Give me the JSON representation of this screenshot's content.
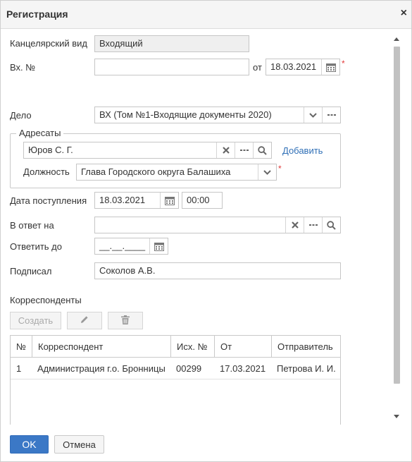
{
  "dialog": {
    "title": "Регистрация",
    "close_glyph": "×"
  },
  "form": {
    "office_type": {
      "label": "Канцелярский вид",
      "value": "Входящий"
    },
    "incoming_no": {
      "label": "Вх. №",
      "value": "",
      "date_label": "от",
      "date_value": "18.03.2021"
    },
    "case": {
      "label": "Дело",
      "value": "ВХ (Том №1-Входящие документы 2020)"
    },
    "addressees": {
      "legend": "Адресаты",
      "person": "Юров С. Г.",
      "add_link": "Добавить",
      "position_label": "Должность",
      "position_value": "Глава Городского округа Балашиха"
    },
    "receipt_date": {
      "label": "Дата поступления",
      "date_value": "18.03.2021",
      "time_value": "00:00"
    },
    "reply_to": {
      "label": "В ответ на",
      "value": ""
    },
    "reply_by": {
      "label": "Ответить до",
      "value": "__.__.____"
    },
    "signed_by": {
      "label": "Подписал",
      "value": "Соколов А.В."
    }
  },
  "correspondents": {
    "title": "Корреспонденты",
    "create_label": "Создать",
    "columns": [
      "№",
      "Корреспондент",
      "Исх. №",
      "От",
      "Отправитель"
    ],
    "rows": [
      [
        "1",
        "Администрация г.о. Бронницы",
        "00299",
        "17.03.2021",
        "Петрова И. И."
      ]
    ]
  },
  "footer": {
    "ok_label": "OK",
    "cancel_label": "Отмена"
  },
  "colors": {
    "primary": "#3b78c6",
    "required": "#e23b3b",
    "link": "#2f6fb6"
  },
  "icons": [
    "calendar-icon",
    "chevron-down-icon",
    "more-icon",
    "clear-icon",
    "search-icon",
    "pencil-icon",
    "trash-icon"
  ]
}
